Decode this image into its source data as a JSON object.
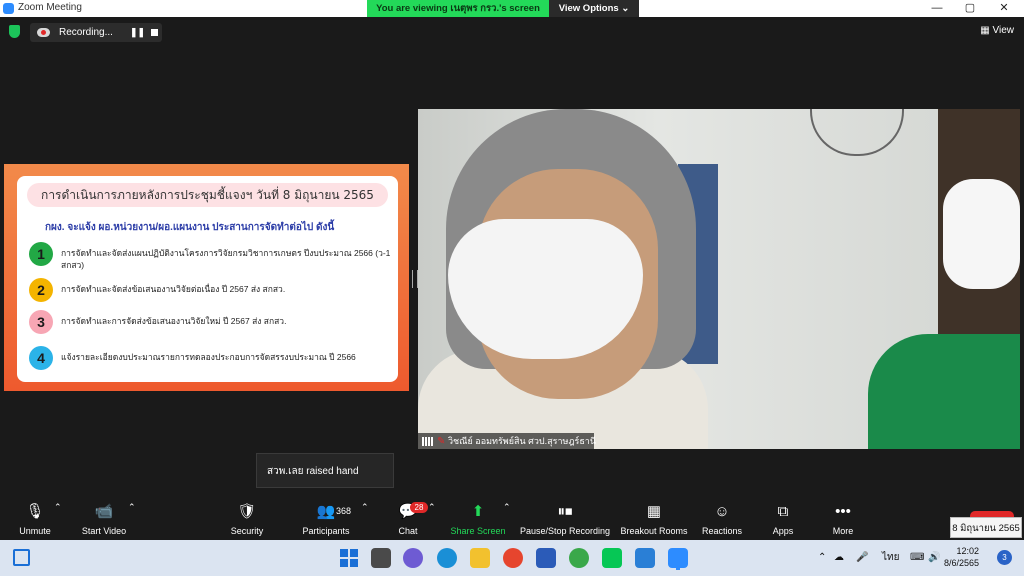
{
  "window": {
    "title": "Zoom Meeting",
    "viewing_banner": "You are viewing เนตุพร กรว.'s screen",
    "view_options": "View Options ⌄",
    "controls": [
      "—",
      "▢",
      "✕"
    ]
  },
  "recording": {
    "label": "Recording...",
    "pause": "❚❚"
  },
  "view_button": "▦ View",
  "slide": {
    "title": "การดำเนินการภายหลังการประชุมชี้แจงฯ วันที่ 8 มิถุนายน 2565",
    "subtitle": "กผง. จะแจ้ง ผอ.หน่วยงาน/ผอ.แผนงาน ประสานการจัดทำต่อไป ดังนี้",
    "items": [
      {
        "num": "1",
        "text": "การจัดทำและจัดส่งแผนปฏิบัติงานโครงการวิจัยกรมวิชาการเกษตร ปีงบประมาณ 2566 (ว-1 สกสว)",
        "color": "#22a845"
      },
      {
        "num": "2",
        "text": "การจัดทำและจัดส่งข้อเสนองานวิจัยต่อเนื่อง ปี 2567 ส่ง สกสว.",
        "color": "#f4b400"
      },
      {
        "num": "3",
        "text": "การจัดทำและการจัดส่งข้อเสนองานวิจัยใหม่ ปี 2567 ส่ง สกสว.",
        "color": "#f7a6b4"
      },
      {
        "num": "4",
        "text": "แจ้งรายละเอียดงบประมาณรายการทดลองประกอบการจัดสรรงบประมาณ ปี 2566",
        "color": "#2bb3e8"
      }
    ]
  },
  "video": {
    "participant_name": "วิชณีย์ ออมทรัพย์สิน ศวป.สุราษฎร์ธานี"
  },
  "toast": "สวพ.เลย raised hand",
  "toolbar": {
    "unmute": "Unmute",
    "start_video": "Start Video",
    "security": "Security",
    "participants": "Participants",
    "participants_count": "368",
    "chat": "Chat",
    "chat_badge": "28",
    "share_screen": "Share Screen",
    "pause_recording": "Pause/Stop Recording",
    "breakout_rooms": "Breakout Rooms",
    "reactions": "Reactions",
    "apps": "Apps",
    "more": "More",
    "end": ""
  },
  "date_tooltip": "8 มิถุนายน 2565",
  "taskbar": {
    "language": "ไทย",
    "time": "12:02",
    "date": "8/6/2565",
    "notifications": "3"
  }
}
